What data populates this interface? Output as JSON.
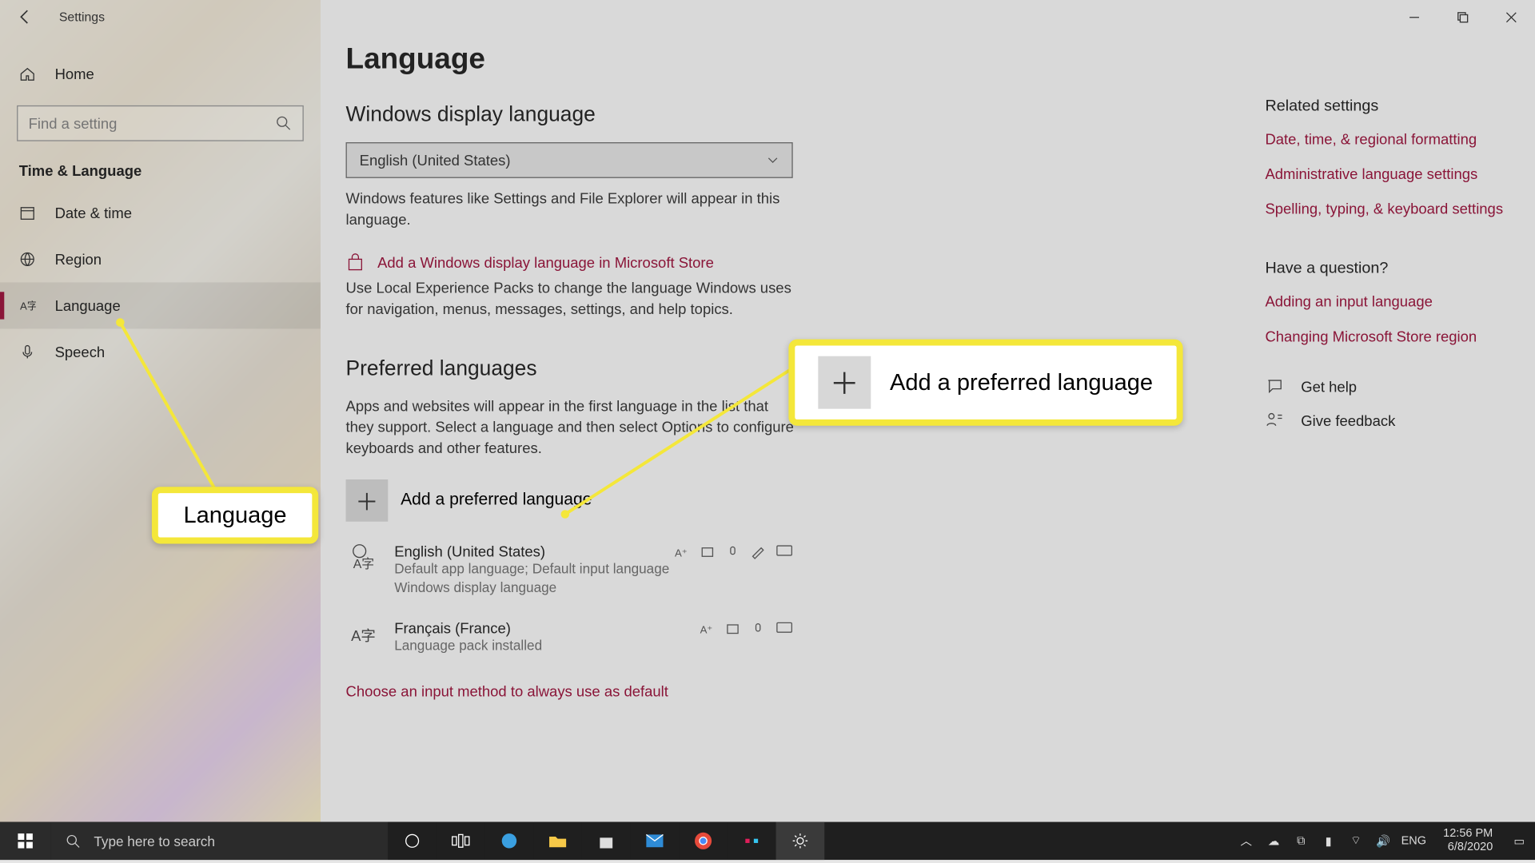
{
  "app_title": "Settings",
  "search_placeholder": "Find a setting",
  "sidebar": {
    "home": "Home",
    "section": "Time & Language",
    "items": [
      {
        "label": "Date & time"
      },
      {
        "label": "Region"
      },
      {
        "label": "Language"
      },
      {
        "label": "Speech"
      }
    ]
  },
  "main": {
    "title": "Language",
    "wdl": {
      "heading": "Windows display language",
      "selected": "English (United States)",
      "desc": "Windows features like Settings and File Explorer will appear in this language.",
      "store_link": "Add a Windows display language in Microsoft Store",
      "store_desc": "Use Local Experience Packs to change the language Windows uses for navigation, menus, messages, settings, and help topics."
    },
    "pref": {
      "heading": "Preferred languages",
      "desc": "Apps and websites will appear in the first language in the list that they support. Select a language and then select Options to configure keyboards and other features.",
      "add_label": "Add a preferred language",
      "langs": [
        {
          "name": "English (United States)",
          "sub": "Default app language; Default input language\nWindows display language"
        },
        {
          "name": "Français (France)",
          "sub": "Language pack installed"
        }
      ],
      "choose_link": "Choose an input method to always use as default"
    }
  },
  "right": {
    "related_heading": "Related settings",
    "related": [
      "Date, time, & regional formatting",
      "Administrative language settings",
      "Spelling, typing, & keyboard settings"
    ],
    "question_heading": "Have a question?",
    "questions": [
      "Adding an input language",
      "Changing Microsoft Store region"
    ],
    "help": "Get help",
    "feedback": "Give feedback"
  },
  "callouts": {
    "lang": "Language",
    "add": "Add a preferred language"
  },
  "taskbar": {
    "search": "Type here to search",
    "lang": "ENG",
    "time": "12:56 PM",
    "date": "6/8/2020"
  }
}
